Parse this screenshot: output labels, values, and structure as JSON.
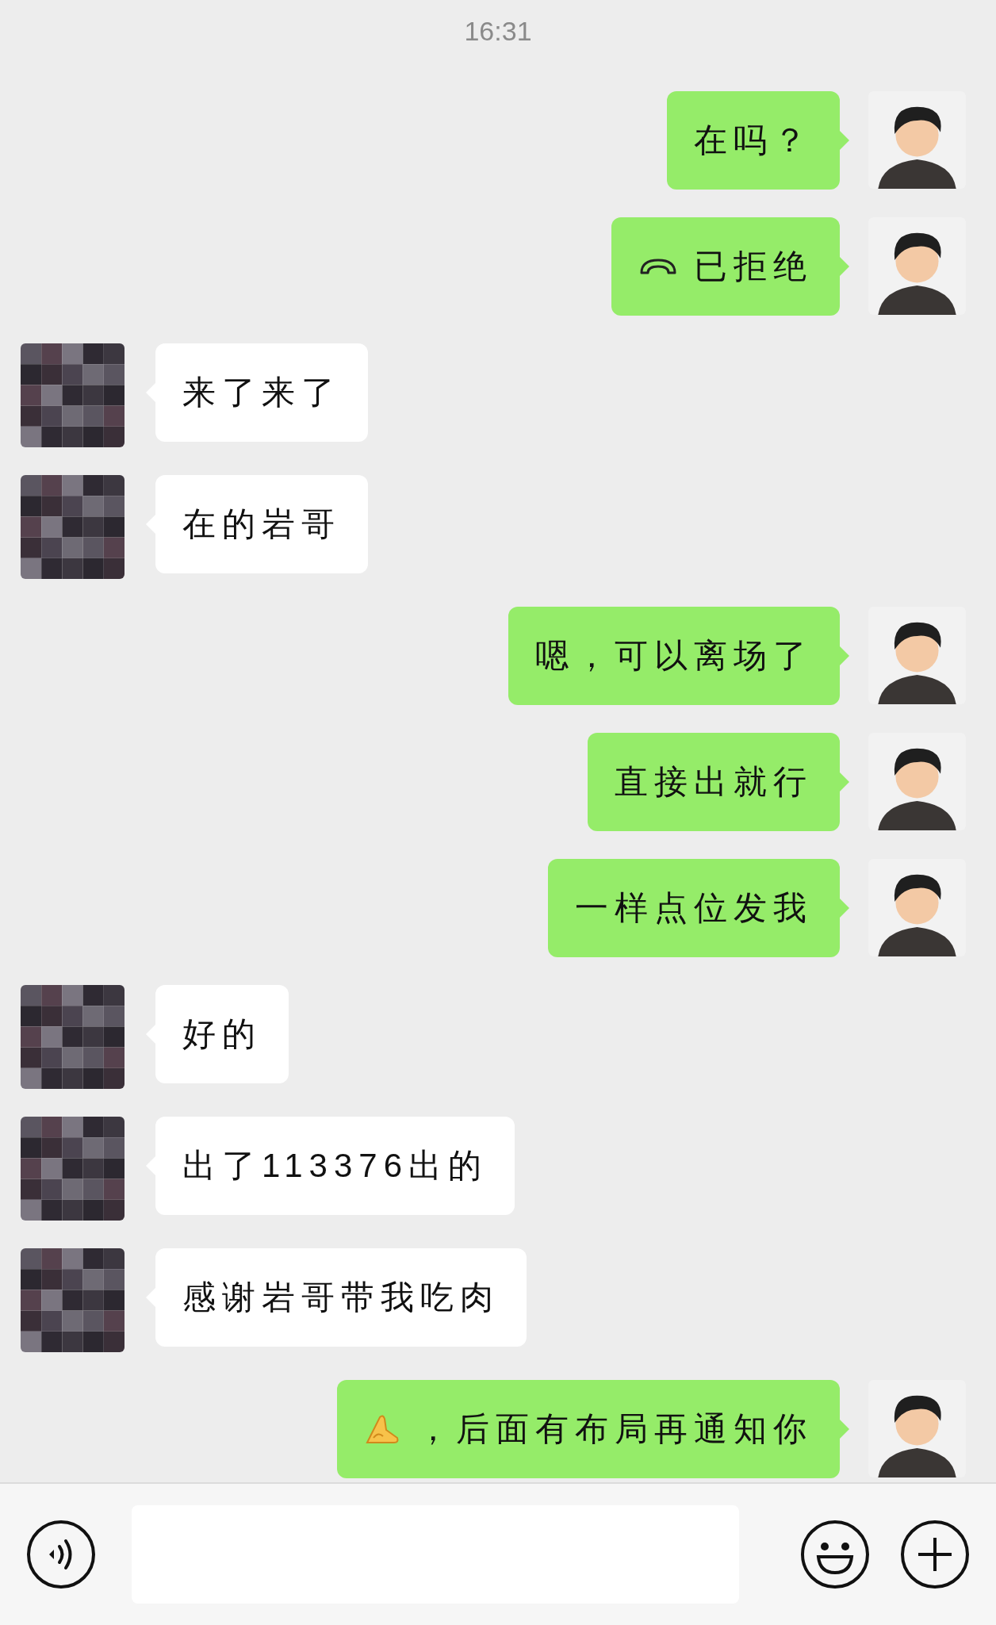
{
  "time": "16:31",
  "messages": [
    {
      "outgoing": true,
      "kind": "text",
      "text": "在吗？"
    },
    {
      "outgoing": true,
      "kind": "call",
      "text": "已拒绝"
    },
    {
      "outgoing": false,
      "kind": "text",
      "text": "来了来了"
    },
    {
      "outgoing": false,
      "kind": "text",
      "text": "在的岩哥"
    },
    {
      "outgoing": true,
      "kind": "text",
      "text": "嗯，可以离场了"
    },
    {
      "outgoing": true,
      "kind": "text",
      "text": "直接出就行"
    },
    {
      "outgoing": true,
      "kind": "text",
      "text": "一样点位发我"
    },
    {
      "outgoing": false,
      "kind": "text",
      "text": "好的"
    },
    {
      "outgoing": false,
      "kind": "text",
      "text": "出了113376出的"
    },
    {
      "outgoing": false,
      "kind": "text",
      "text": "感谢岩哥带我吃肉"
    },
    {
      "outgoing": true,
      "kind": "emoji",
      "text": "，后面有布局再通知你"
    }
  ]
}
